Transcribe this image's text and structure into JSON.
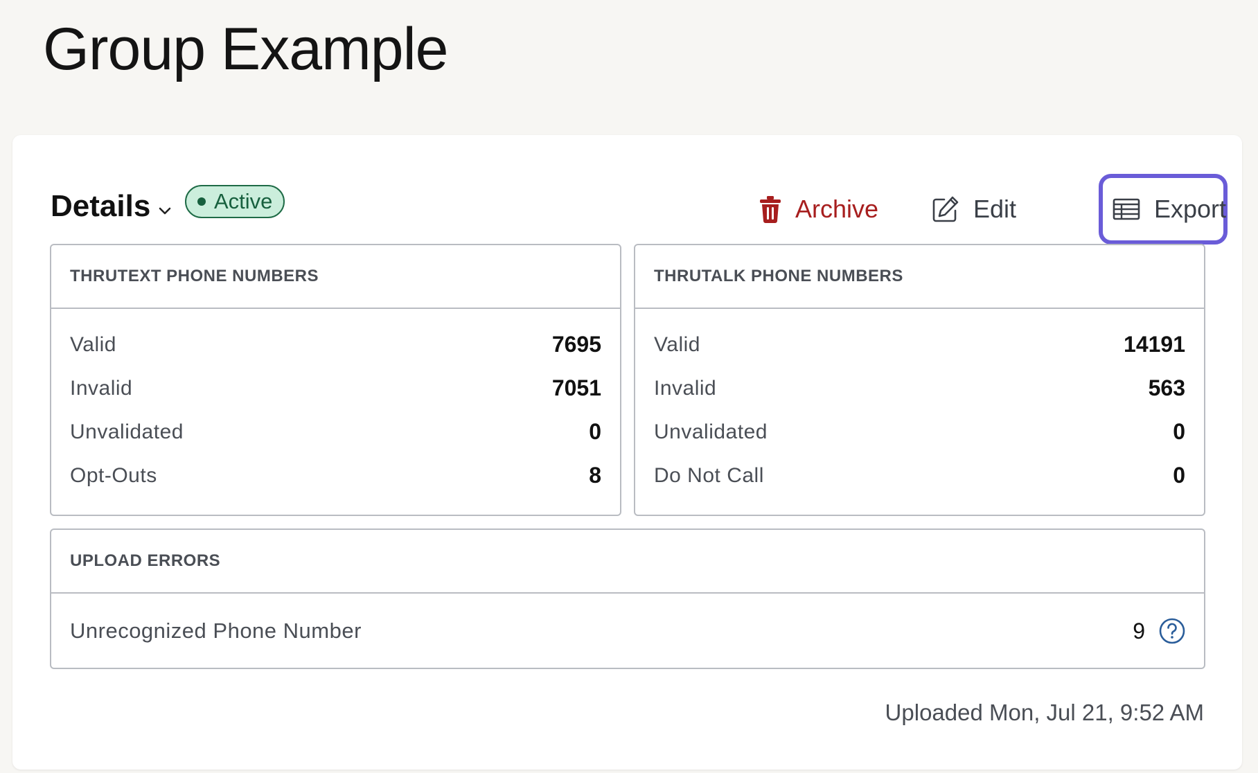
{
  "page": {
    "title": "Group Example"
  },
  "details": {
    "title": "Details",
    "status": "Active",
    "actions": {
      "archive": "Archive",
      "edit": "Edit",
      "export": "Export"
    }
  },
  "thrutext": {
    "heading": "THRUTEXT PHONE NUMBERS",
    "rows": [
      {
        "label": "Valid",
        "value": "7695"
      },
      {
        "label": "Invalid",
        "value": "7051"
      },
      {
        "label": "Unvalidated",
        "value": "0"
      },
      {
        "label": "Opt-Outs",
        "value": "8"
      }
    ]
  },
  "thrutalk": {
    "heading": "THRUTALK PHONE NUMBERS",
    "rows": [
      {
        "label": "Valid",
        "value": "14191"
      },
      {
        "label": "Invalid",
        "value": "563"
      },
      {
        "label": "Unvalidated",
        "value": "0"
      },
      {
        "label": "Do Not Call",
        "value": "0"
      }
    ]
  },
  "errors": {
    "heading": "UPLOAD ERRORS",
    "rows": [
      {
        "label": "Unrecognized Phone Number",
        "value": "9"
      }
    ]
  },
  "footer": {
    "uploaded": "Uploaded Mon, Jul 21, 9:52 AM"
  },
  "colors": {
    "archive": "#a71e1e",
    "active_badge_bg": "#cbeedc",
    "active_badge_text": "#17603e",
    "focus_ring": "#6a5cd8",
    "help_icon": "#2a5d9a"
  },
  "icons": {
    "archive": "trash-icon",
    "edit": "pencil-icon",
    "export": "table-icon",
    "details": "chevron-down-icon",
    "help": "question-circle-icon"
  }
}
